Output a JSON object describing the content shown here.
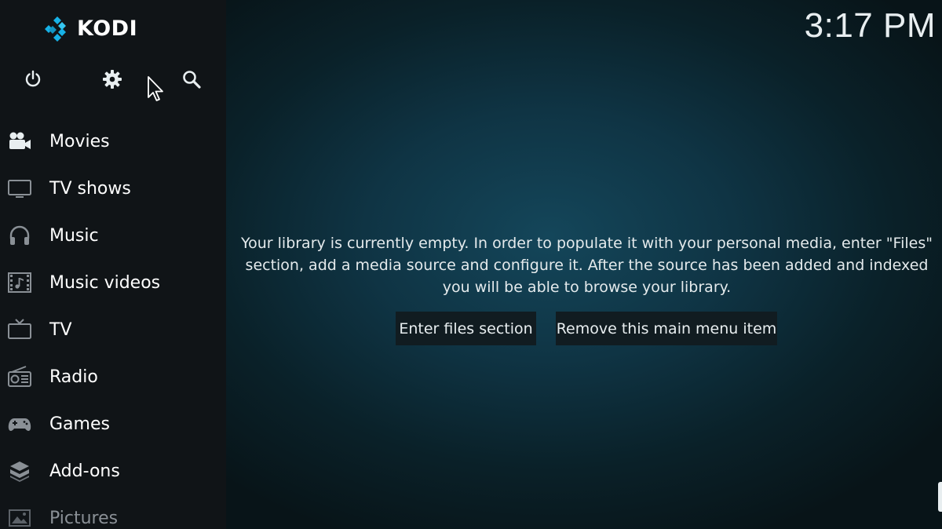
{
  "app": {
    "logo_text": "KODI",
    "clock": "3:17 PM"
  },
  "top_icons": [
    {
      "icon": "power-icon"
    },
    {
      "icon": "gear-icon"
    },
    {
      "icon": "search-icon"
    }
  ],
  "menu": {
    "items": [
      {
        "label": "Movies",
        "icon": "movie-camera-icon"
      },
      {
        "label": "TV shows",
        "icon": "monitor-icon"
      },
      {
        "label": "Music",
        "icon": "headphones-icon"
      },
      {
        "label": "Music videos",
        "icon": "music-video-icon"
      },
      {
        "label": "TV",
        "icon": "tv-icon"
      },
      {
        "label": "Radio",
        "icon": "radio-icon"
      },
      {
        "label": "Games",
        "icon": "gamepad-icon"
      },
      {
        "label": "Add-ons",
        "icon": "addons-box-icon"
      },
      {
        "label": "Pictures",
        "icon": "pictures-icon"
      }
    ]
  },
  "content": {
    "message": "Your library is currently empty. In order to populate it with your personal media, enter \"Files\" section, add a media source and configure it. After the source has been added and indexed you will be able to browse your library.",
    "enter_files_label": "Enter files section",
    "remove_item_label": "Remove this main menu item"
  },
  "colors": {
    "sidebar_bg": "#101417",
    "accent_blue": "#17b2e7",
    "button_bg": "#111c21"
  }
}
